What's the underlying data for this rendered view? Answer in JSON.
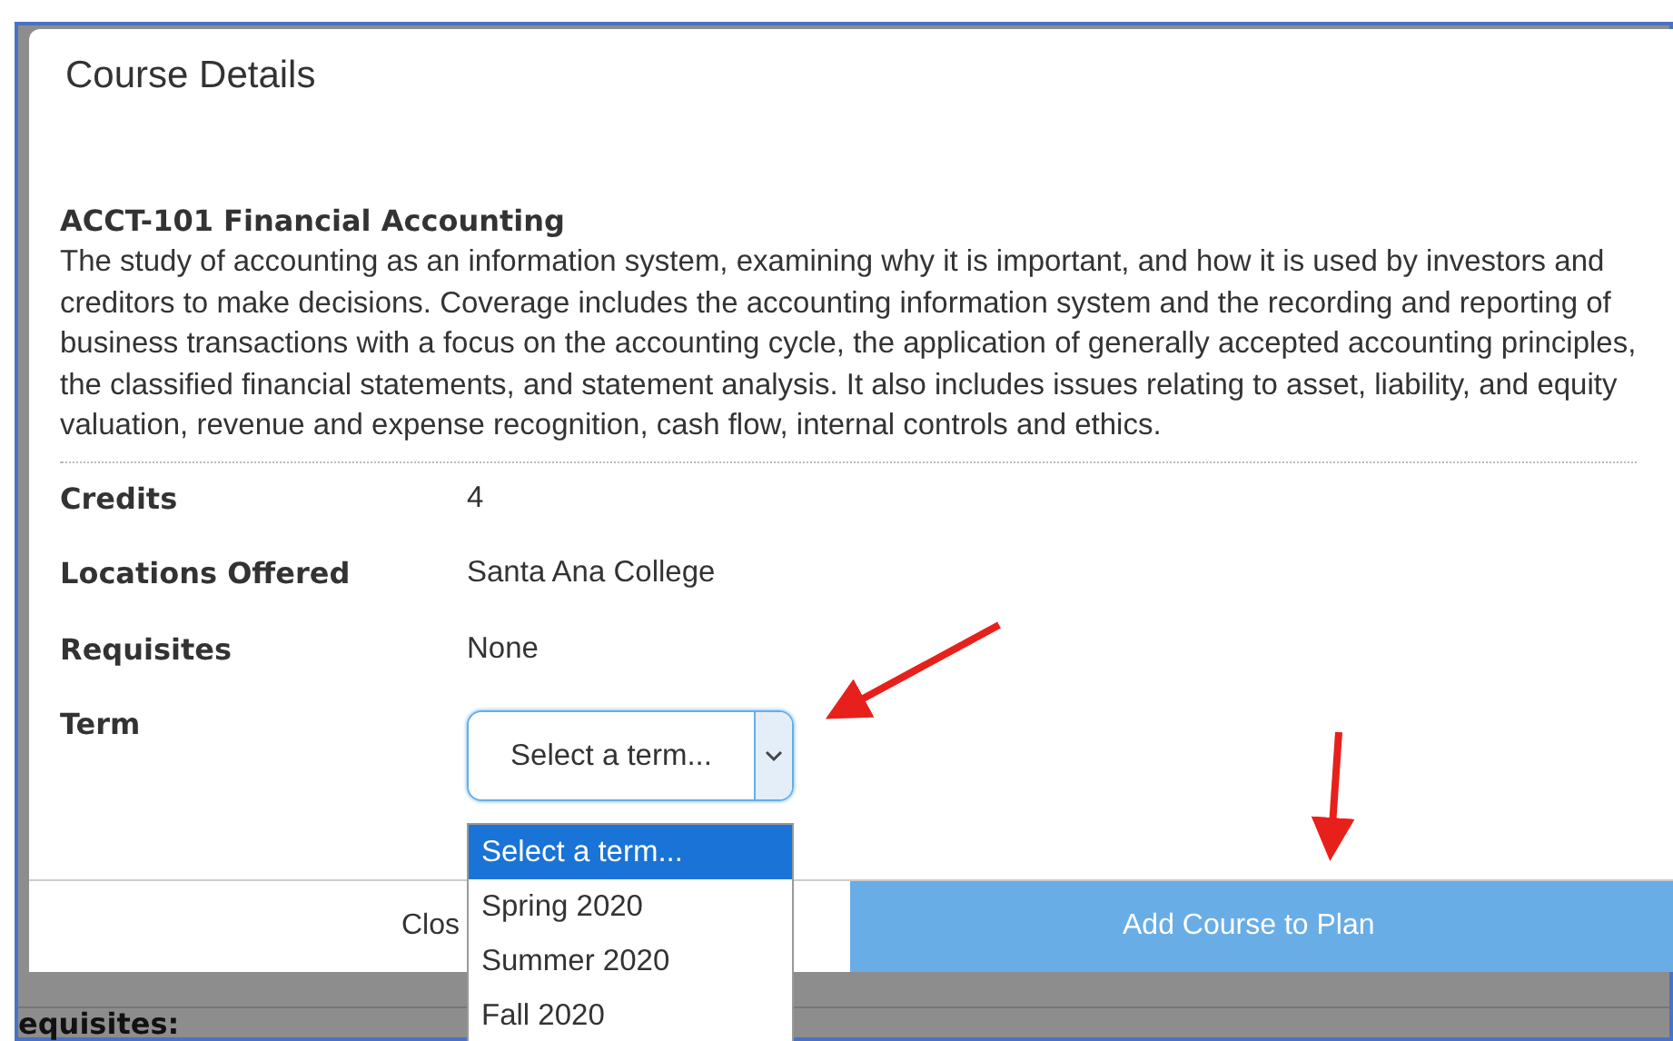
{
  "background": {
    "heading": "equisites:"
  },
  "modal": {
    "title": "Course Details",
    "course_title": "ACCT-101 Financial Accounting",
    "description": "The study of accounting as an information system, examining why it is important, and how it is used by investors and creditors to make decisions. Coverage includes the accounting information system and the recording and reporting of business transactions with a focus on the accounting cycle, the application of generally accepted accounting principles, the classified financial statements, and statement analysis. It also includes issues relating to asset, liability, and equity valuation, revenue and expense recognition, cash flow, internal controls and ethics.",
    "details": [
      {
        "label": "Credits",
        "value": "4"
      },
      {
        "label": "Locations Offered",
        "value": "Santa Ana College"
      },
      {
        "label": "Requisites",
        "value": "None"
      }
    ],
    "term": {
      "label": "Term",
      "value": "Select a term...",
      "expanded": true,
      "options": [
        {
          "label": "Select a term...",
          "selected": true
        },
        {
          "label": "Spring 2020",
          "selected": false
        },
        {
          "label": "Summer 2020",
          "selected": false
        },
        {
          "label": "Fall 2020",
          "selected": false
        }
      ]
    },
    "buttons": [
      {
        "label": "Clos",
        "kind": "secondary"
      },
      {
        "label": "Add Course to Plan",
        "kind": "primary"
      }
    ]
  }
}
